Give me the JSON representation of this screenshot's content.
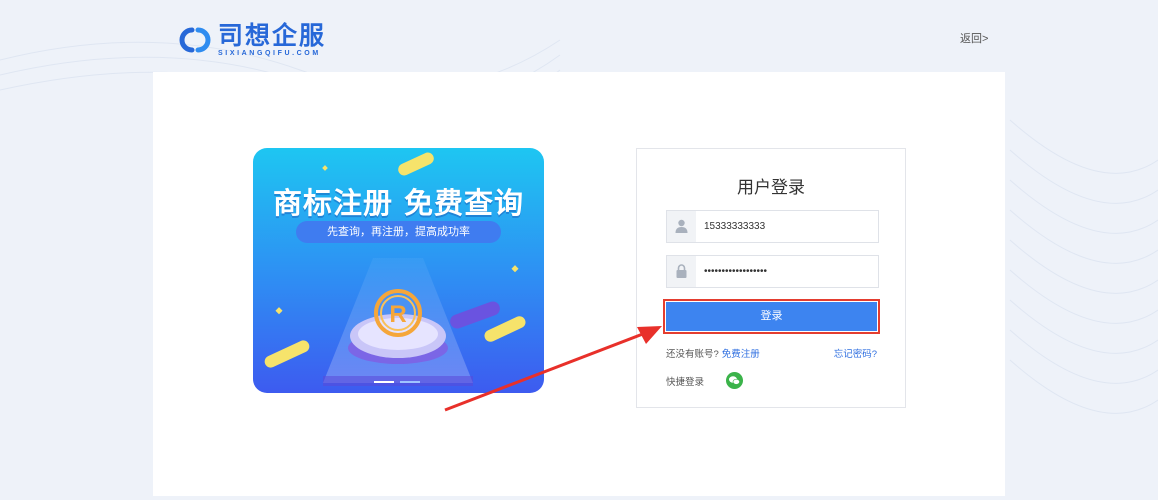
{
  "header": {
    "logo_cn": "司想企服",
    "logo_en": "SIXIANGQIFU.COM",
    "back_label": "返回>"
  },
  "banner": {
    "title": "商标注册 免费查询",
    "subtitle": "先查询，再注册，提高成功率"
  },
  "login": {
    "title": "用户登录",
    "username_value": "15333333333",
    "password_value": "••••••••••••••••••",
    "submit_label": "登录",
    "no_account_text": "还没有账号?",
    "register_link": "免费注册",
    "forgot_link": "忘记密码?",
    "quick_login_label": "快捷登录"
  },
  "colors": {
    "brand": "#2768d8",
    "button": "#3d84f0",
    "highlight": "#e43d2f",
    "wechat": "#3bb34a"
  },
  "icons": [
    "logo-mark-icon",
    "user-icon",
    "lock-icon",
    "wechat-icon",
    "trademark-r-icon",
    "annotation-arrow"
  ]
}
